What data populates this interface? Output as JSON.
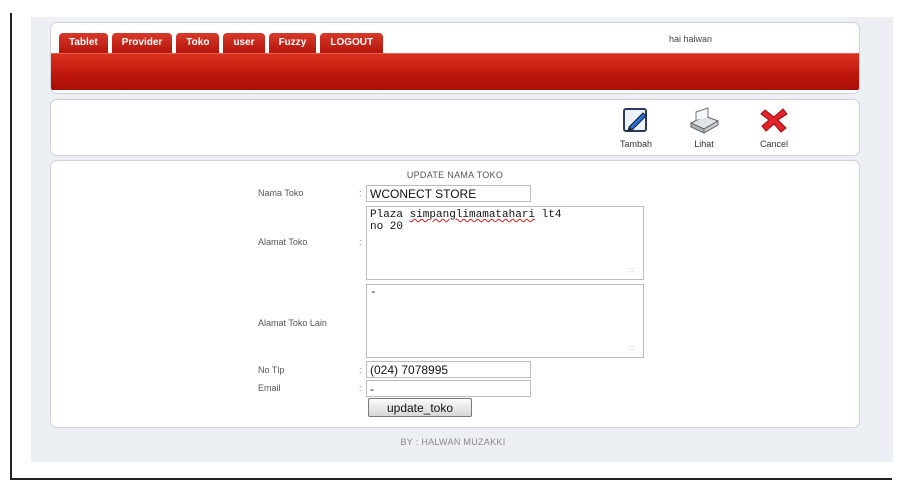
{
  "nav": {
    "tabs": [
      "Tablet",
      "Provider",
      "Toko",
      "user",
      "Fuzzy",
      "LOGOUT"
    ],
    "greeting": "hai halwan"
  },
  "toolbar": {
    "tambah": {
      "label": "Tambah",
      "icon": "edit-icon"
    },
    "lihat": {
      "label": "Lihat",
      "icon": "view-icon"
    },
    "cancel": {
      "label": "Cancel",
      "icon": "cancel-icon"
    }
  },
  "form": {
    "title": "UPDATE NAMA TOKO",
    "separator": ":",
    "nama_toko": {
      "label": "Nama Toko",
      "value": "WCONECT STORE"
    },
    "alamat_toko": {
      "label": "Alamat Toko",
      "value_prefix": "Plaza ",
      "value_misspelled": "simpanglimamatahari",
      "value_suffix": " lt4\nno 20"
    },
    "alamat_toko_lain": {
      "label": "Alamat Toko Lain",
      "value": "-"
    },
    "no_tlp": {
      "label": "No Tlp",
      "value": "(024) 7078995"
    },
    "email": {
      "label": "Email",
      "value": "-"
    },
    "submit_label": "update_toko",
    "resize_grip": ".::"
  },
  "footer": {
    "credit": "BY : HALWAN MUZAKKI"
  },
  "colors": {
    "accent_red": "#c0170c",
    "panel_bg": "#ffffff",
    "page_bg": "#eceff3"
  }
}
